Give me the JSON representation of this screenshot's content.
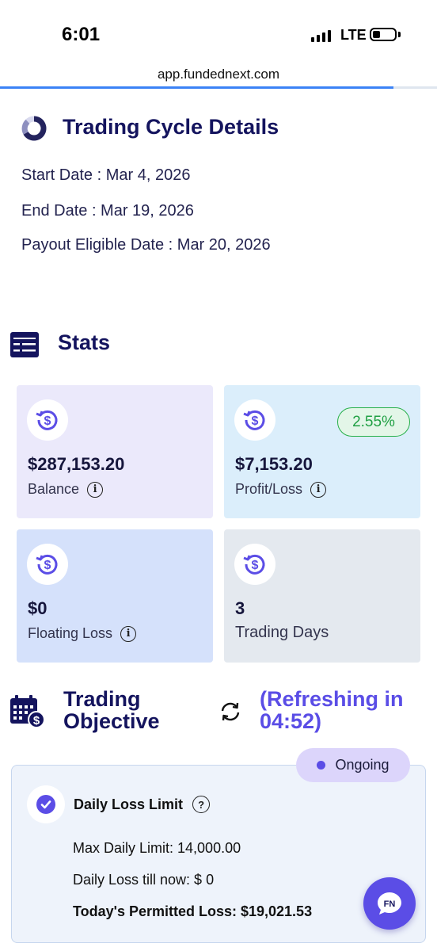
{
  "status_bar": {
    "time": "6:01",
    "network": "LTE",
    "battery_level": 0.35
  },
  "browser": {
    "url": "app.fundednext.com",
    "load_progress": 0.9
  },
  "cycle": {
    "title": "Trading Cycle Details",
    "start": "Start Date : Mar 4, 2026",
    "end": "End Date : Mar 19, 2026",
    "payout": "Payout Eligible Date : Mar 20, 2026"
  },
  "stats": {
    "title": "Stats",
    "cards": [
      {
        "value": "$287,153.20",
        "label": "Balance",
        "has_info": true,
        "bg": "#ebe9fb"
      },
      {
        "value": "$7,153.20",
        "label": "Profit/Loss",
        "has_info": true,
        "badge": "2.55%",
        "bg": "#dbeefb"
      },
      {
        "value": "$0",
        "label": "Floating Loss",
        "has_info": true,
        "bg": "#d5e1fb"
      },
      {
        "value": "3",
        "label": "Trading Days",
        "has_info": false,
        "bg": "#e4e9ef"
      }
    ]
  },
  "objective": {
    "title_line1": "Trading",
    "title_line2": "Objective",
    "refresh_line1": "(Refreshing in",
    "refresh_line2": "04:52)",
    "status": "Ongoing",
    "item_title": "Daily Loss Limit",
    "question_mark": "?",
    "max_daily_limit": "Max Daily Limit: 14,000.00",
    "daily_loss_now": "Daily Loss till now: $ 0",
    "permitted_loss": "Today's Permitted Loss: $19,021.53"
  },
  "colors": {
    "accent": "#5b4de6",
    "heading": "#14145e",
    "success": "#20a044"
  },
  "icons": {
    "cycle": "ring-chart-icon",
    "stats": "dashboard-card-icon",
    "card": "dollar-refresh-icon",
    "objective": "calendar-money-icon",
    "refresh": "refresh-icon",
    "check": "check-circle-icon",
    "chat": "chat-logo-icon"
  }
}
